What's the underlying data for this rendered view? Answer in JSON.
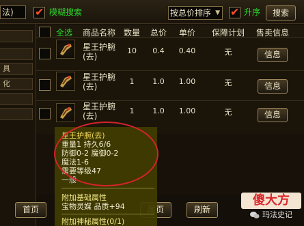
{
  "topbar": {
    "left_field_value": "法)",
    "fuzzy_search_label": "模糊搜索",
    "sort_select_value": "按总价排序",
    "ascending_label": "升序",
    "search_button": "搜索"
  },
  "left_strip": {
    "tab_texts": [
      "",
      "",
      "具",
      "化",
      "",
      ""
    ]
  },
  "table": {
    "select_all_label": "全选",
    "headers": [
      "商品名称",
      "数量",
      "总价",
      "单价",
      "保障计划",
      "售卖信息"
    ],
    "rows": [
      {
        "name_line1": "星王护腕",
        "name_line2": "(去)",
        "quantity": "10",
        "total": "0.4",
        "unit": "0.40",
        "guarantee": "无",
        "info_button": "信息"
      },
      {
        "name_line1": "星王护腕",
        "name_line2": "(去)",
        "quantity": "1",
        "total": "1.0",
        "unit": "1.00",
        "guarantee": "无",
        "info_button": "信息"
      },
      {
        "name_line1": "星王护腕",
        "name_line2": "(去)",
        "quantity": "1",
        "total": "1.0",
        "unit": "1.00",
        "guarantee": "无",
        "info_button": "信息"
      }
    ]
  },
  "tooltip": {
    "title": "星王护腕(去)",
    "lines": [
      "重量1 持久6/6",
      "防御0-2 魔御0-2",
      "魔法1-6",
      "需要等级47",
      "一般"
    ],
    "section_basic": "附加基础属性",
    "basic_line": "宝物灵媒 品质+94",
    "section_more": "附加神秘属性(0/1)"
  },
  "pager": {
    "first_page": "首页",
    "last_page": "尾页",
    "refresh": "刷新"
  },
  "watermark": {
    "logo_text": "傻大方",
    "account_text": "玛法史记"
  },
  "colors": {
    "accent_red": "#d4222b",
    "tooltip_bg": "#423c00",
    "checkbox_mark": "#ff4f2b",
    "label_green": "#2bd42b"
  }
}
